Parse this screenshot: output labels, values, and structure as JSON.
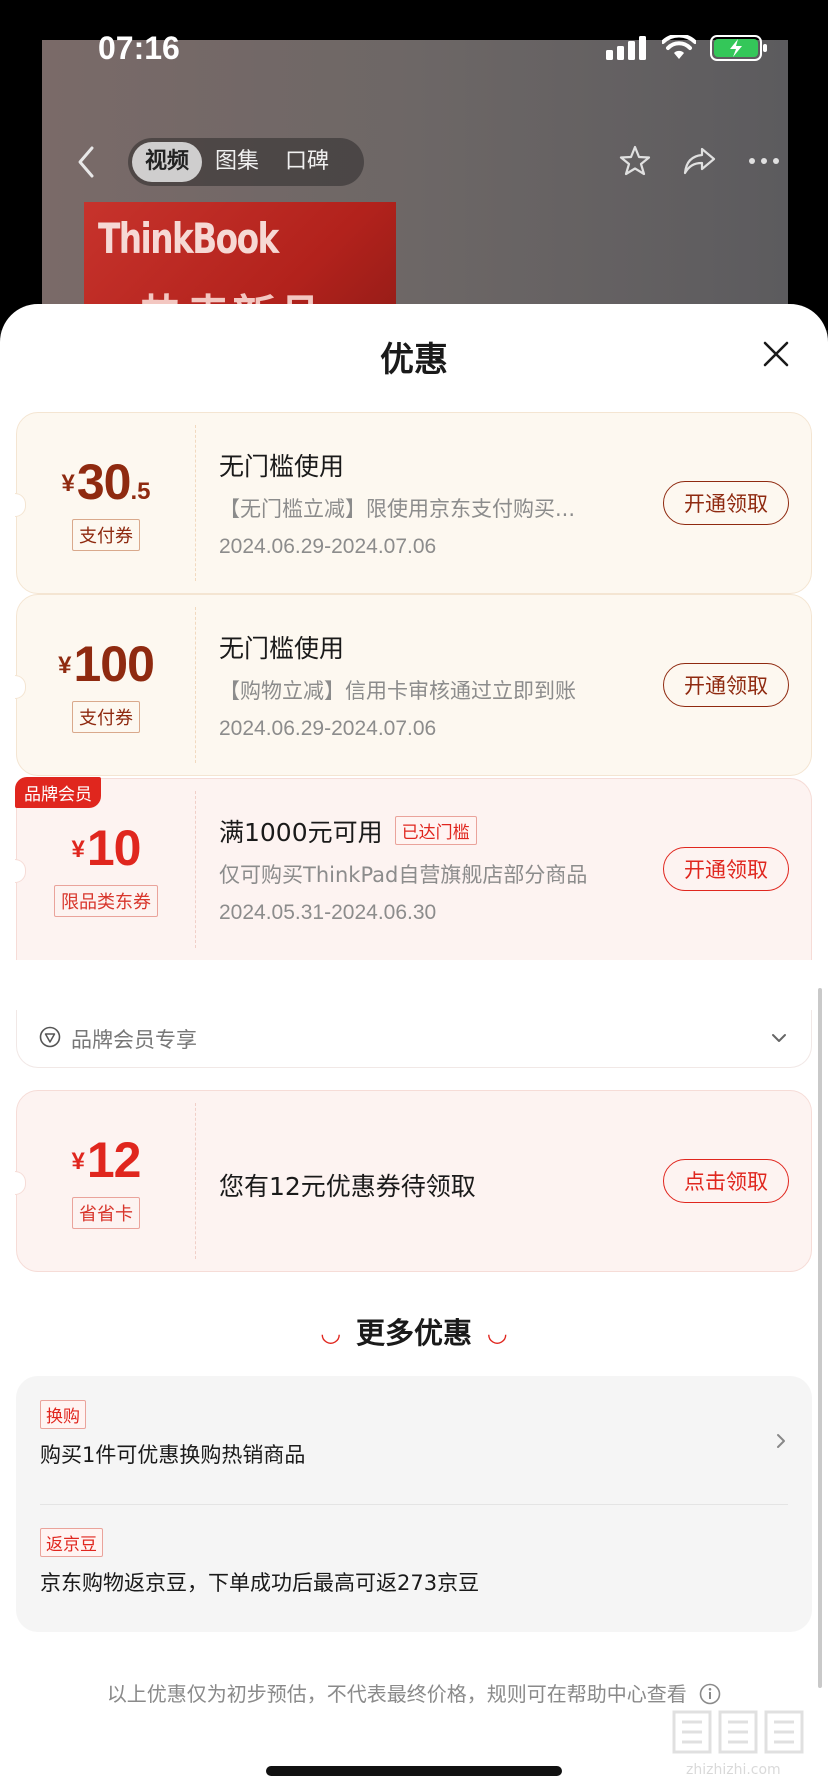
{
  "status_bar": {
    "time": "07:16"
  },
  "video_header": {
    "tabs": [
      {
        "label": "视频",
        "active": true
      },
      {
        "label": "图集",
        "active": false
      },
      {
        "label": "口碑",
        "active": false
      }
    ],
    "promo": {
      "brand": "ThinkBook",
      "slogan": "热卖新品"
    }
  },
  "sheet": {
    "title": "优惠",
    "coupons": [
      {
        "currency": "¥",
        "amount": "30",
        "decimal": ".5",
        "type_tag": "支付券",
        "title": "无门槛使用",
        "desc": "【无门槛立减】限使用京东支付购买...",
        "date": "2024.06.29-2024.07.06",
        "button": "开通领取"
      },
      {
        "currency": "¥",
        "amount": "100",
        "type_tag": "支付券",
        "title": "无门槛使用",
        "desc": "【购物立减】信用卡审核通过立即到账",
        "date": "2024.06.29-2024.07.06",
        "button": "开通领取"
      },
      {
        "corner_badge": "品牌会员",
        "currency": "¥",
        "amount": "10",
        "type_tag": "限品类东券",
        "title": "满1000元可用",
        "title_badge": "已达门槛",
        "desc": "仅可购买ThinkPad自营旗舰店部分商品",
        "date": "2024.05.31-2024.06.30",
        "button": "开通领取",
        "footer": "品牌会员专享"
      },
      {
        "currency": "¥",
        "amount": "12",
        "type_tag": "省省卡",
        "title": "您有12元优惠券待领取",
        "button": "点击领取"
      }
    ],
    "more": {
      "title": "更多优惠",
      "items": [
        {
          "tag": "换购",
          "text": "购买1件可优惠换购热销商品"
        },
        {
          "tag": "返京豆",
          "text": "京东购物返京豆，下单成功后最高可返273京豆"
        }
      ]
    },
    "disclaimer": "以上优惠仅为初步预估，不代表最终价格，规则可在帮助中心查看"
  },
  "watermark": {
    "text": "zhizhizhi.com"
  },
  "colors": {
    "brand_red": "#e0261e",
    "coupon_brown": "#8f2a10"
  }
}
